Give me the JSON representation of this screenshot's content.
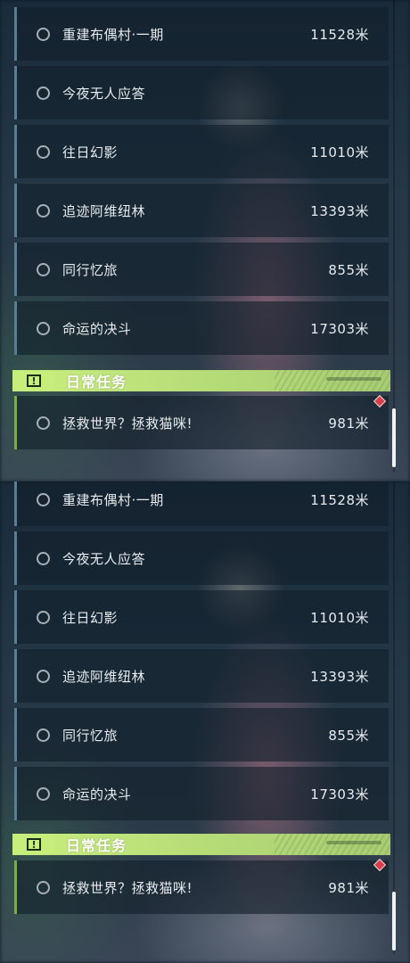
{
  "panels": [
    {
      "quests": [
        {
          "title": "重建布偶村·一期",
          "distance": "11528米"
        },
        {
          "title": "今夜无人应答",
          "distance": ""
        },
        {
          "title": "往日幻影",
          "distance": "11010米"
        },
        {
          "title": "追迹阿维纽林",
          "distance": "13393米"
        },
        {
          "title": "同行忆旅",
          "distance": "855米"
        },
        {
          "title": "命运的决斗",
          "distance": "17303米"
        }
      ],
      "daily_section": {
        "title": "日常任务",
        "icon": "exclamation-icon",
        "quests": [
          {
            "title": "拯救世界？拯救猫咪!",
            "distance": "981米"
          }
        ]
      }
    },
    {
      "quests": [
        {
          "title": "重建布偶村·一期",
          "distance": "11528米"
        },
        {
          "title": "今夜无人应答",
          "distance": ""
        },
        {
          "title": "往日幻影",
          "distance": "11010米"
        },
        {
          "title": "追迹阿维纽林",
          "distance": "13393米"
        },
        {
          "title": "同行忆旅",
          "distance": "855米"
        },
        {
          "title": "命运的决斗",
          "distance": "17303米"
        }
      ],
      "daily_section": {
        "title": "日常任务",
        "icon": "exclamation-icon",
        "quests": [
          {
            "title": "拯救世界？拯救猫咪!",
            "distance": "981米"
          }
        ]
      }
    }
  ],
  "colors": {
    "accent_green": "#c6ee7a",
    "row_border": "#5b7d8f",
    "daily_border": "#7ea85a",
    "alert_red": "#d6404c",
    "text": "#e8ecef"
  }
}
